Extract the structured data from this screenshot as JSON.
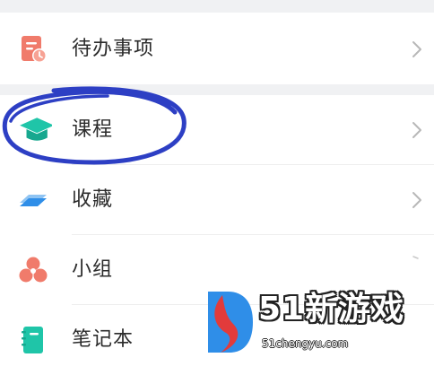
{
  "menu": {
    "items": [
      {
        "label": "待办事项",
        "icon": "todo-clock-icon",
        "color": "#f07b6b"
      },
      {
        "label": "课程",
        "icon": "graduation-cap-icon",
        "color": "#1fc5a8"
      },
      {
        "label": "收藏",
        "icon": "layers-icon",
        "color": "#2f8ee8"
      },
      {
        "label": "小组",
        "icon": "group-circles-icon",
        "color": "#f07b6b"
      },
      {
        "label": "笔记本",
        "icon": "notebook-icon",
        "color": "#1fc5a8"
      }
    ]
  },
  "annotation": {
    "color": "#2d3fc4"
  },
  "watermark": {
    "brand": "51新游戏",
    "url": "51chengyu.com"
  }
}
